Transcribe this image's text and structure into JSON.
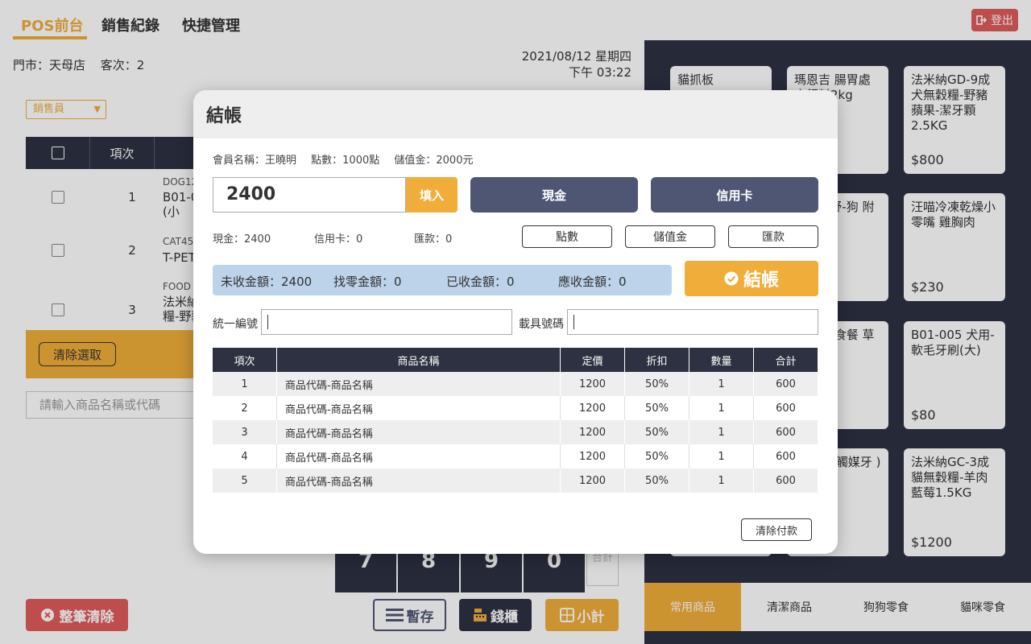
{
  "colors": {
    "accent": "#f0ad3a",
    "dark": "#2d3142",
    "slate": "#4e5674",
    "danger": "#e05c5c",
    "summary_bg": "#bcd3ea"
  },
  "header": {
    "tabs": [
      {
        "label": "POS前台",
        "active": true
      },
      {
        "label": "銷售紀錄",
        "active": false
      },
      {
        "label": "快捷管理",
        "active": false
      }
    ],
    "logout_label": "登出"
  },
  "left": {
    "store": "門市：天母店",
    "customer_count": "客次：2",
    "date": "2021/08/12 星期四",
    "time": "下午 03:22",
    "salesperson_placeholder": "銷售員",
    "table_header_index": "項次",
    "rows": [
      {
        "index": "1",
        "code": "DOG12",
        "name": "B01-0 刷(小"
      },
      {
        "index": "2",
        "code": "CAT45",
        "name": "T-PET"
      },
      {
        "index": "3",
        "code": "FOOD",
        "name": "法米納 糧-野豬"
      }
    ],
    "clear_selection_label": "清除選取",
    "search_placeholder": "請輸入商品名稱或代碼",
    "numpad": [
      "7",
      "8",
      "9",
      "0"
    ],
    "subtotal_small": "合計",
    "buttons": {
      "clear_all": "整筆清除",
      "hold": "暫存",
      "drawer": "錢櫃",
      "subtotal": "小計"
    }
  },
  "right": {
    "products": [
      {
        "name": "貓抓板",
        "price": ""
      },
      {
        "name": "瑪恩吉 腸胃處方飼料2kg",
        "price": ""
      },
      {
        "name": "法米納GD-9成犬無穀糧-野豬蘋果-潔牙顆2.5KG",
        "price": "$800"
      },
      {
        "name": "",
        "price": ""
      },
      {
        "name": "g 潔齒舒-狗 附食品 )",
        "price": ""
      },
      {
        "name": "汪喵冷凍乾燥小零嘴 雞胸肉",
        "price": "$230"
      },
      {
        "name": "",
        "price": ""
      },
      {
        "name": "狗冷凍 食餐 草 0g",
        "price": ""
      },
      {
        "name": "B01-005 犬用-軟毛牙刷(大)",
        "price": "$80"
      },
      {
        "name": "",
        "price": ""
      },
      {
        "name": "ky兩用 觸媒牙 )",
        "price": ""
      },
      {
        "name": "法米納GC-3成貓無穀糧-羊肉藍莓1.5KG",
        "price": "$1200"
      }
    ],
    "categories": [
      {
        "label": "常用商品",
        "active": true
      },
      {
        "label": "清潔商品",
        "active": false
      },
      {
        "label": "狗狗零食",
        "active": false
      },
      {
        "label": "貓咪零食",
        "active": false
      }
    ]
  },
  "modal": {
    "title": "結帳",
    "member_name": "會員名稱：王曉明",
    "points": "點數：1000點",
    "stored_value": "儲值金：2000元",
    "amount": "2400",
    "fill_label": "填入",
    "cash_label": "現金",
    "credit_label": "信用卡",
    "cash_summary": "現金：2400",
    "credit_summary": "信用卡：0",
    "transfer_summary": "匯款：0",
    "points_btn": "點數",
    "stored_btn": "儲值金",
    "transfer_btn": "匯款",
    "unpaid": "未收金額：2400",
    "change": "找零金額：0",
    "received": "已收金額：0",
    "receivable": "應收金額：0",
    "checkout_label": "結帳",
    "tax_id_label": "統一編號",
    "carrier_label": "載具號碼",
    "table": {
      "headers": [
        "項次",
        "商品名稱",
        "定價",
        "折扣",
        "數量",
        "合計"
      ],
      "rows": [
        [
          "1",
          "商品代碼-商品名稱",
          "1200",
          "50%",
          "1",
          "600"
        ],
        [
          "2",
          "商品代碼-商品名稱",
          "1200",
          "50%",
          "1",
          "600"
        ],
        [
          "3",
          "商品代碼-商品名稱",
          "1200",
          "50%",
          "1",
          "600"
        ],
        [
          "4",
          "商品代碼-商品名稱",
          "1200",
          "50%",
          "1",
          "600"
        ],
        [
          "5",
          "商品代碼-商品名稱",
          "1200",
          "50%",
          "1",
          "600"
        ]
      ]
    },
    "clear_payment_label": "清除付款"
  }
}
